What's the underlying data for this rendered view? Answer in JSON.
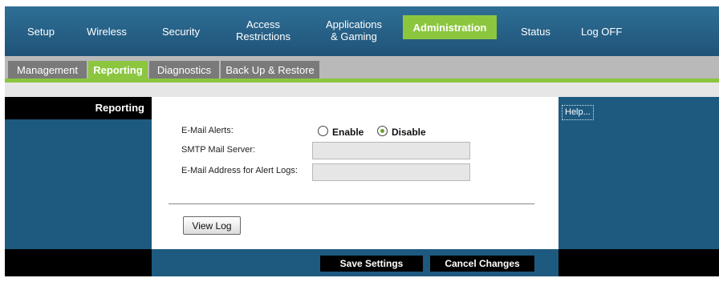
{
  "top_nav": {
    "items": [
      {
        "label": "Setup"
      },
      {
        "label": "Wireless"
      },
      {
        "label": "Security"
      },
      {
        "label": "Access\nRestrictions"
      },
      {
        "label": "Applications\n& Gaming"
      },
      {
        "label": "Administration"
      },
      {
        "label": "Status"
      },
      {
        "label": "Log OFF"
      }
    ],
    "active_color": "#8cc63f"
  },
  "sub_tabs": [
    {
      "label": "Management"
    },
    {
      "label": "Reporting"
    },
    {
      "label": "Diagnostics"
    },
    {
      "label": "Back Up & Restore"
    }
  ],
  "sidebar": {
    "title": "Reporting"
  },
  "help": {
    "label": "Help..."
  },
  "form": {
    "email_alerts_label": "E-Mail Alerts:",
    "enable_label": "Enable",
    "disable_label": "Disable",
    "selected": "Disable",
    "smtp_label": "SMTP Mail Server:",
    "smtp_value": "",
    "email_address_label": "E-Mail Address for Alert Logs:",
    "email_address_value": ""
  },
  "view_log_label": "View Log",
  "footer": {
    "save_label": "Save Settings",
    "cancel_label": "Cancel Changes"
  },
  "colors": {
    "nav_blue": "#1f5378",
    "panel_blue": "#1e5a80",
    "green": "#8cc63f"
  }
}
